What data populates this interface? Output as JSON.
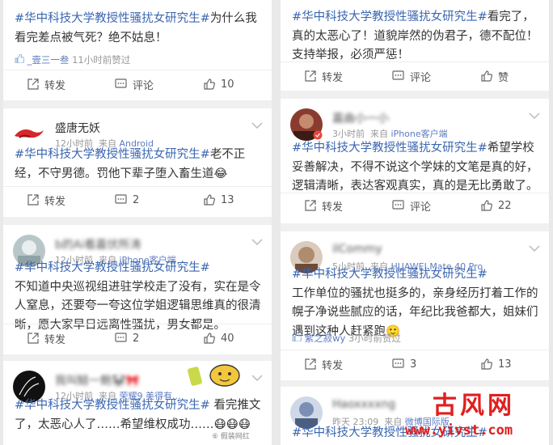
{
  "left_column": {
    "card1": {
      "text_tag": "#华中科技大学教授性骚扰女研究生#",
      "text_rest": "为什么我看完差点被气死？绝不姑息！",
      "liker": "_壹三一叁",
      "liked_time": "11小时前赞过",
      "repost": "转发",
      "comment": "评论",
      "likes": "10"
    },
    "card2": {
      "username": "盛唐无妖",
      "time": "12小时前",
      "source_prefix": "来自",
      "source": "Android",
      "text_tag": "#华中科技大学教授性骚扰女研究生#",
      "text_rest": "老不正经，不守男德。罚他下辈子堕入畜生道😂",
      "repost": "转发",
      "comments": "2",
      "likes": "13"
    },
    "card3": {
      "username": "b的Ai看嘉伏所涛",
      "time": "12小时前",
      "source_prefix": "来自",
      "source": "iPhone客户端",
      "text_tag": "#华中科技大学教授性骚扰女研究生#",
      "text_rest": "不知道中央巡视组进驻学校走了没有，实在是令人窒息，还要夸一夸这位学姐逻辑思维真的很清晰，愿大家早日远离性骚扰，男女都是。",
      "repost": "转发",
      "comments": "2",
      "likes": "40"
    },
    "card4": {
      "username": "我叫鲢一鲍🐼🎀",
      "time": "12小时前",
      "source_prefix": "来自",
      "source": "荣耀9 美得有...",
      "text_tag": "#华中科技大学教授性骚扰女研究生#",
      "text_rest": " 看完推文了，太恶心人了……希望维权成功……😷😷😷"
    }
  },
  "right_column": {
    "card1": {
      "text_tag": "#华中科技大学教授性骚扰女研究生#",
      "text_rest": "看完了，真的太恶心了！道貌岸然的伪君子，德不配位！支持举报，必须严惩！",
      "repost": "转发",
      "comment": "评论",
      "like": "赞"
    },
    "card2": {
      "username": "嘉曲小一小",
      "time": "3小时前",
      "source_prefix": "来自",
      "source": "iPhone客户端",
      "text_tag": "#华中科技大学教授性骚扰女研究生#",
      "text_rest": "希望学校妥善解决，不得不说这个学妹的文笔是真的好，逻辑清晰，表达客观真实，真的是无比勇敢了。",
      "repost": "转发",
      "comment": "评论",
      "likes": "22"
    },
    "card3": {
      "username": "ilCommy",
      "time": "5小时前",
      "source_prefix": "来自",
      "source": "HUAWEI Mate 40 Pro",
      "text_tag": "#华中科技大学教授性骚扰女研究生#",
      "text_rest": "工作单位的骚扰也挺多的，亲身经历打着工作的幌子净说些腻应的话，年纪比我爸都大，姐妹们遇到这种人赶紧跑🙂",
      "liker": "紫之寂wy",
      "liked_time": "3小时前赞过",
      "repost": "转发",
      "comments": "3",
      "likes": "13"
    },
    "card4": {
      "username": "Haoxxxxng",
      "time": "昨天 23:09",
      "source_prefix": "来自",
      "source": "微博国际版",
      "text_tag": "#华中科技大学教授性骚扰女研究生#"
    }
  },
  "watermark": {
    "chinese": "古风网",
    "url": "www.yivst.com",
    "source_note": "⑥ 假装网红"
  },
  "colors": {
    "hashtag": "#3b66b0",
    "meta_gray": "#999999",
    "watermark_red": "#e01f1f"
  }
}
